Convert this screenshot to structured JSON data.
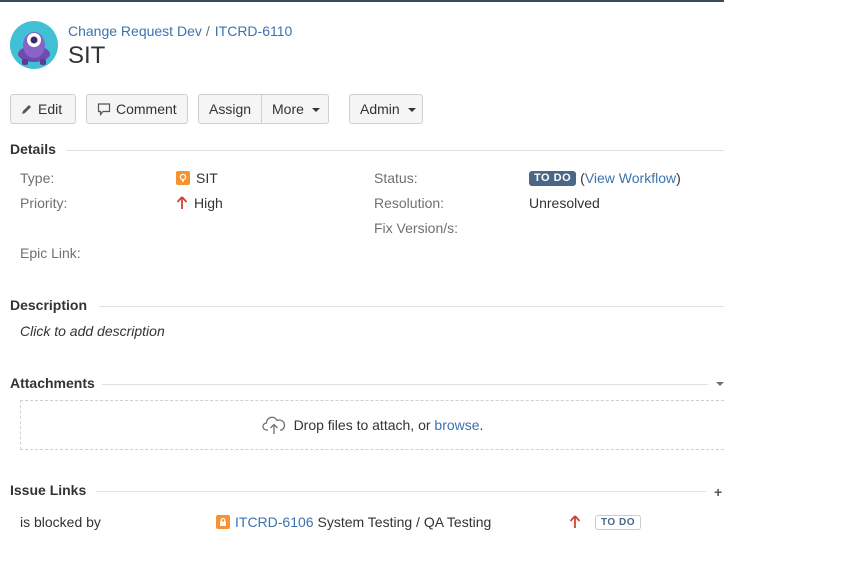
{
  "breadcrumb": {
    "project": "Change Request Dev",
    "separator": "/",
    "issue_key": "ITCRD-6110"
  },
  "issue": {
    "title": "SIT"
  },
  "toolbar": {
    "edit": "Edit",
    "comment": "Comment",
    "assign": "Assign",
    "more": "More",
    "admin": "Admin"
  },
  "details": {
    "heading": "Details",
    "type_label": "Type:",
    "type_value": "SIT",
    "priority_label": "Priority:",
    "priority_value": "High",
    "epic_label": "Epic Link:",
    "status_label": "Status:",
    "status_value": "TO DO",
    "view_workflow_open": "(",
    "view_workflow": "View Workflow",
    "view_workflow_close": ")",
    "resolution_label": "Resolution:",
    "resolution_value": "Unresolved",
    "fix_label": "Fix Version/s:"
  },
  "description": {
    "heading": "Description",
    "placeholder": "Click to add description"
  },
  "attachments": {
    "heading": "Attachments",
    "drop_text": "Drop files to attach, or",
    "browse": "browse",
    "period": "."
  },
  "issue_links": {
    "heading": "Issue Links",
    "rows": [
      {
        "relation": "is blocked by",
        "key": "ITCRD-6106",
        "summary": "System Testing / QA Testing",
        "status": "TO DO"
      }
    ]
  },
  "colors": {
    "accent": "#3b73af",
    "lozenge": "#4a6785",
    "priority_high": "#d04437",
    "type_icon": "#f79232"
  }
}
